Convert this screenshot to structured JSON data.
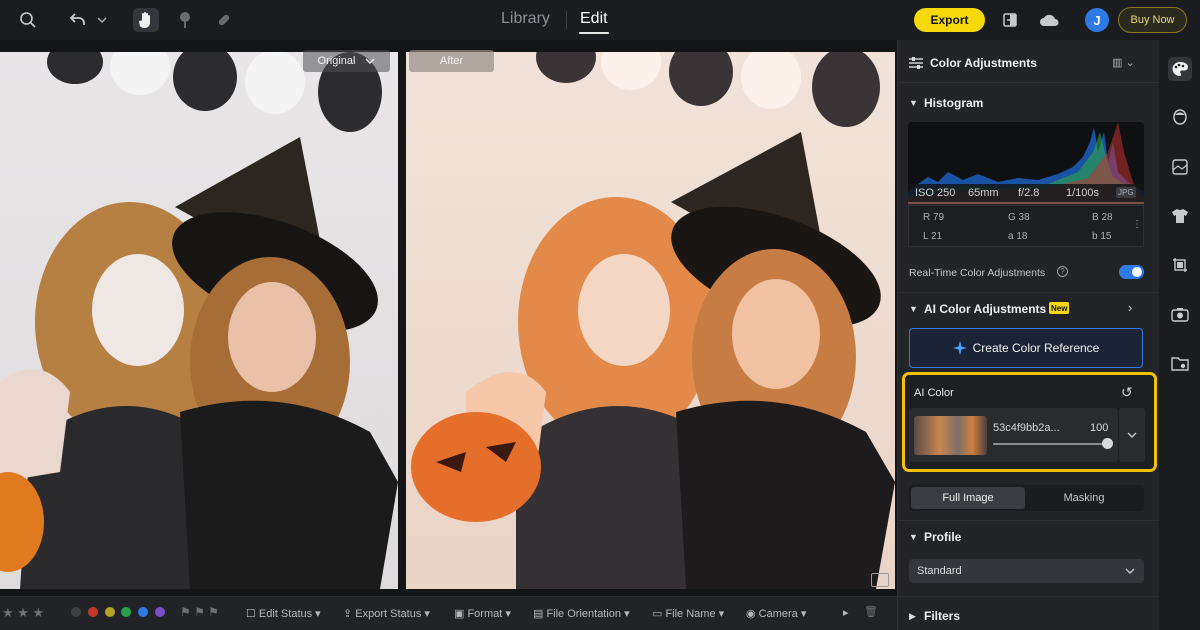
{
  "topbar": {
    "tabs": [
      {
        "label": "Library"
      },
      {
        "label": "Edit"
      }
    ],
    "active_tab": "Edit",
    "export_label": "Export",
    "avatar_initial": "J",
    "buy_label": "Buy Now",
    "icons": [
      "search-icon",
      "undo-icon",
      "chevron-down-icon",
      "hand-icon",
      "brush-icon",
      "bandage-icon",
      "compare-icon",
      "cloud-icon"
    ]
  },
  "canvas": {
    "label_original": "Original",
    "label_after": "After",
    "colors": {
      "accent": "#2f7be5",
      "highlight": "#f2c20a",
      "export": "#f5d90a"
    }
  },
  "bottombar": {
    "color_labels": [
      "#3e4045",
      "#c0392b",
      "#b8a32a",
      "#27a34a",
      "#2f7be5",
      "#7a4fc7"
    ],
    "filters": [
      {
        "label": "Edit Status"
      },
      {
        "label": "Export Status"
      },
      {
        "label": "Format"
      },
      {
        "label": "File Orientation"
      },
      {
        "label": "File Name"
      },
      {
        "label": "Camera"
      }
    ]
  },
  "panel": {
    "header": "Color Adjustments",
    "histogram_title": "Histogram",
    "exif": {
      "iso": "ISO 250",
      "focal": "65mm",
      "aperture": "f/2.8",
      "shutter": "1/100s",
      "format": "JPG"
    },
    "rgb": {
      "r": "R 79",
      "g": "G 38",
      "b": "B 28",
      "l": "L 21",
      "a": "a 18",
      "b2": "b 15"
    },
    "realtime_label": "Real-Time Color Adjustments",
    "realtime_on": true,
    "ai_section_title": "AI Color Adjustments",
    "new_badge": "New",
    "create_ref_label": "Create Color Reference",
    "ai_color_title": "AI Color",
    "ai_preset_name": "53c4f9bb2a...",
    "ai_intensity": "100",
    "seg_full": "Full Image",
    "seg_masking": "Masking",
    "profile_title": "Profile",
    "profile_value": "Standard",
    "filters_title": "Filters"
  }
}
